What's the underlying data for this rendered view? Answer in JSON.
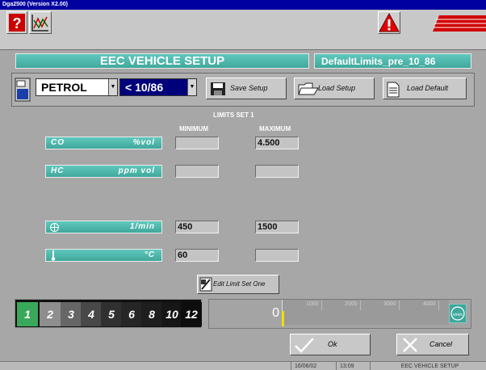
{
  "window": {
    "title": "Dga2500 (Version X2.00)"
  },
  "header": {
    "title": "EEC VEHICLE SETUP",
    "profile": "DefaultLimits_pre_10_86"
  },
  "controls": {
    "fuel": "PETROL",
    "date": "< 10/86",
    "save_label": "Save Setup",
    "load_setup_label": "Load Setup",
    "load_default_label": "Load Default"
  },
  "limits": {
    "set_title": "LIMITS SET 1",
    "min_header": "MINIMUM",
    "max_header": "MAXIMUM",
    "rows": [
      {
        "name": "CO",
        "unit": "%vol",
        "min": "",
        "max": "4.500"
      },
      {
        "name": "HC",
        "unit": "ppm vol",
        "min": "",
        "max": ""
      },
      {
        "name": "",
        "unit": "1/min",
        "min": "450",
        "max": "1500",
        "icon": "engine-speed-icon"
      },
      {
        "name": "",
        "unit": "°C",
        "min": "60",
        "max": "",
        "icon": "thermometer-icon"
      }
    ]
  },
  "edit_label": "Edit Limit Set One",
  "limit_sets": [
    "1",
    "2",
    "3",
    "4",
    "5",
    "6",
    "8",
    "10",
    "12"
  ],
  "active_limit_set": "1",
  "rpm": {
    "value": "0",
    "ticks": [
      "1000",
      "2000",
      "3000",
      "4000"
    ],
    "icon_label": "n/min"
  },
  "buttons": {
    "ok": "Ok",
    "cancel": "Cancel"
  },
  "status": {
    "date": "16/06/02",
    "time": "13:09",
    "screen": "EEC VEHICLE SETUP"
  },
  "colors": {
    "accent": "#4ab5aa",
    "selection": "#00007a",
    "marker": "#f0e000"
  }
}
